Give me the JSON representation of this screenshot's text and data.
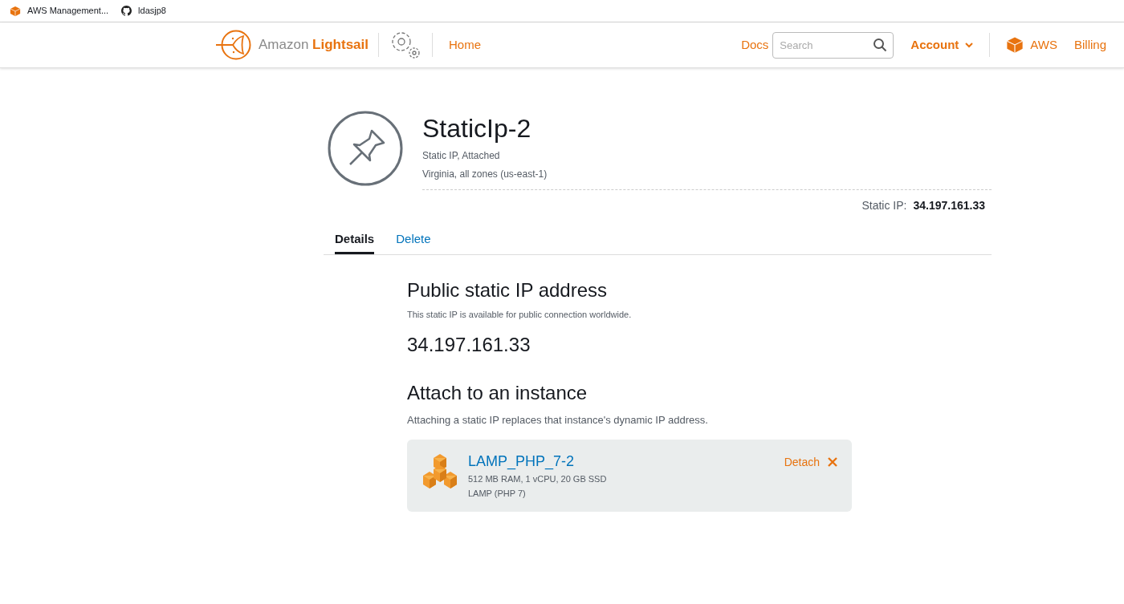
{
  "bookmarks": [
    {
      "kind": "aws",
      "label": "AWS Management..."
    },
    {
      "kind": "github",
      "label": "ldasjp8"
    }
  ],
  "header": {
    "brand_prefix": "Amazon",
    "brand_name": "Lightsail",
    "nav": [
      "Home"
    ],
    "docs": "Docs",
    "search": {
      "placeholder": "Search"
    },
    "account": "Account",
    "aws": "AWS",
    "billing": "Billing"
  },
  "resource": {
    "title": "StaticIp-2",
    "subtitle": "Static IP, Attached",
    "region": "Virginia, all zones (us-east-1)",
    "ip_label": "Static IP:",
    "ip_value": "34.197.161.33"
  },
  "tabs": [
    {
      "label": "Details",
      "selected": true
    },
    {
      "label": "Delete",
      "selected": false
    }
  ],
  "public_section": {
    "heading": "Public static IP address",
    "description": "This static IP is available for public connection worldwide.",
    "ip": "34.197.161.33"
  },
  "attach_section": {
    "heading": "Attach to an instance",
    "description": "Attaching a static IP replaces that instance's dynamic IP address.",
    "instance": {
      "name": "LAMP_PHP_7-2",
      "specs": "512 MB RAM, 1 vCPU, 20 GB SSD",
      "blueprint": "LAMP (PHP 7)",
      "action": "Detach"
    }
  }
}
